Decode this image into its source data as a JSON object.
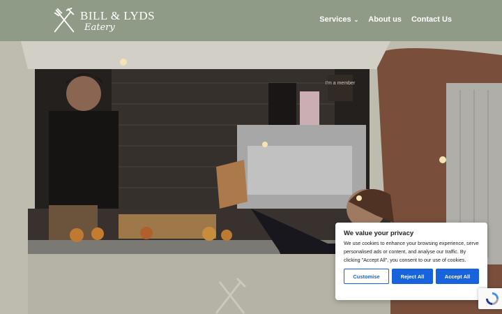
{
  "header": {
    "logo_title": "BILL & LYDS",
    "logo_script": "Eatery",
    "nav": [
      {
        "label": "Services",
        "has_dropdown": true
      },
      {
        "label": "About us"
      },
      {
        "label": "Contact Us"
      }
    ]
  },
  "hero": {
    "sign_text": "I'm a member"
  },
  "cookie": {
    "title": "We value your privacy",
    "text": "We use cookies to enhance your browsing experience, serve personalised ads or content, and analyse our traffic. By clicking \"Accept All\", you consent to our use of cookies.",
    "customise_label": "Customise",
    "reject_label": "Reject All",
    "accept_label": "Accept All"
  },
  "colors": {
    "header_bg": "#8f9a87",
    "button_blue": "#1863dc"
  },
  "icons": {
    "logo": "fork-wheat-icon",
    "dropdown": "chevron-down-icon",
    "recaptcha": "recaptcha-icon"
  }
}
